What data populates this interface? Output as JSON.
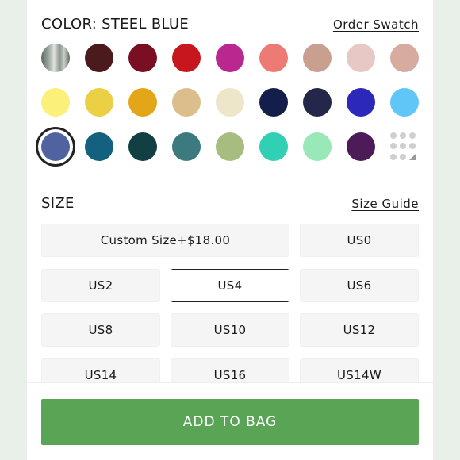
{
  "color": {
    "title": "COLOR:",
    "selected_name": "STEEL BLUE",
    "order_swatch_label": "Order Swatch",
    "swatches": [
      [
        "photo",
        "#4a1a1c",
        "#7a0f24",
        "#c8161e",
        "#b9278f",
        "#ee7a76",
        "#c9a090",
        "#e8c8c4",
        "#d7aba0"
      ],
      [
        "#fbf07a",
        "#ebcf44",
        "#e3a618",
        "#dcbd8c",
        "#ede6c9",
        "#131f4a",
        "#24264a",
        "#2c28b9",
        "#5fc6f7"
      ],
      [
        "#5063a0",
        "#14617f",
        "#113f42",
        "#3c7a80",
        "#a7bd7f",
        "#31cfb3",
        "#98e8b8",
        "#4d1b58",
        "more"
      ]
    ],
    "selected_index": [
      2,
      0
    ],
    "swatch_icons": {
      "photo": "fabric-photo-icon",
      "more": "more-colors-grid-icon"
    }
  },
  "size": {
    "title": "SIZE",
    "size_guide_label": "Size Guide",
    "options": [
      "Custom Size+$18.00",
      "US0",
      "US2",
      "US4",
      "US6",
      "US8",
      "US10",
      "US12",
      "US14",
      "US16",
      "US14W"
    ],
    "selected": "US4"
  },
  "footer": {
    "add_to_bag_label": "ADD TO BAG",
    "accent": "#59a455"
  }
}
